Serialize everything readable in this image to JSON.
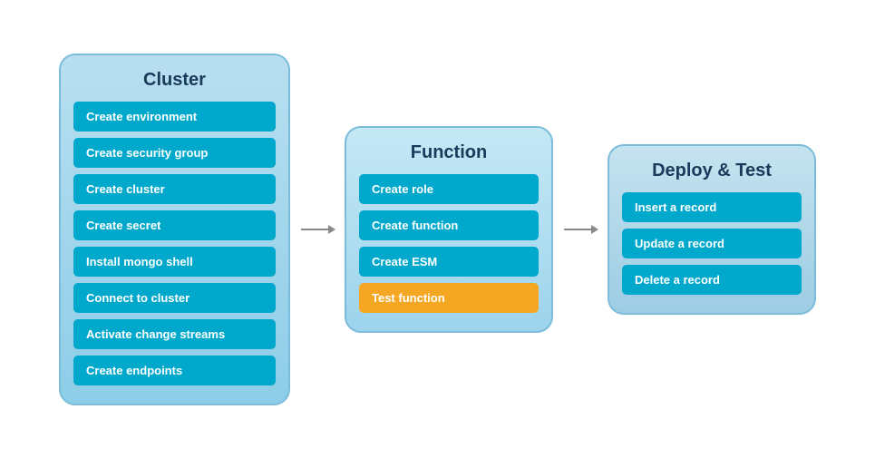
{
  "cluster": {
    "title": "Cluster",
    "items": [
      {
        "label": "Create environment"
      },
      {
        "label": "Create security group"
      },
      {
        "label": "Create cluster"
      },
      {
        "label": "Create secret"
      },
      {
        "label": "Install mongo shell"
      },
      {
        "label": "Connect to cluster"
      },
      {
        "label": "Activate change streams"
      },
      {
        "label": "Create endpoints"
      }
    ]
  },
  "function": {
    "title": "Function",
    "items": [
      {
        "label": "Create role",
        "style": "normal"
      },
      {
        "label": "Create function",
        "style": "normal"
      },
      {
        "label": "Create ESM",
        "style": "normal"
      },
      {
        "label": "Test function",
        "style": "orange"
      }
    ]
  },
  "deploy": {
    "title": "Deploy & Test",
    "items": [
      {
        "label": "Insert a record"
      },
      {
        "label": "Update a record"
      },
      {
        "label": "Delete a record"
      }
    ]
  },
  "arrows": {
    "color": "#888"
  }
}
